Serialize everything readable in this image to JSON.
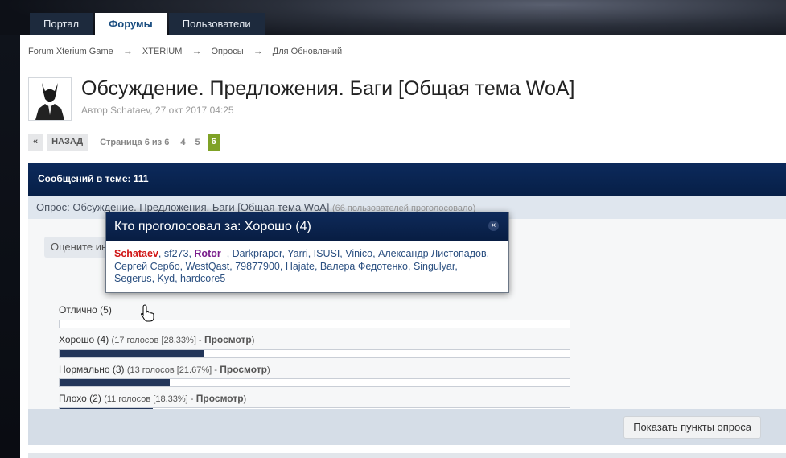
{
  "nav": {
    "tabs": [
      {
        "label": "Портал",
        "active": false
      },
      {
        "label": "Форумы",
        "active": true
      },
      {
        "label": "Пользователи",
        "active": false
      }
    ]
  },
  "breadcrumb": [
    "Forum Xterium Game",
    "XTERIUM",
    "Опросы",
    "Для Обновлений"
  ],
  "breadcrumb_separator": "→",
  "topic": {
    "title": "Обсуждение. Предложения. Баги [Общая тема WoA]",
    "meta": "Автор Schataev, 27 окт 2017 04:25"
  },
  "pager": {
    "prev": "«",
    "back": "НАЗАД",
    "info": "Страница 6 из 6",
    "pages": [
      "4",
      "5"
    ],
    "current": "6"
  },
  "thread": {
    "messages": "Сообщений в теме: 111"
  },
  "poll": {
    "header": "Опрос: Обсуждение. Предложения. Баги [Общая тема WoA]",
    "voted": "(66 пользователей проголосовало)",
    "question": "Оцените ин",
    "view_label": "Просмотр",
    "options": [
      {
        "label": "Отлично (5)",
        "info": "",
        "percent": 0
      },
      {
        "label": "Хорошо (4)",
        "info": "(17 голосов [28.33%] -",
        "percent": 28.33
      },
      {
        "label": "Нормально (3)",
        "info": "(13 голосов [21.67%] -",
        "percent": 21.67
      },
      {
        "label": "Плохо (2)",
        "info": "(11 голосов [18.33%] -",
        "percent": 18.33
      }
    ],
    "show_button": "Показать пункты опроса"
  },
  "popup": {
    "title": "Кто проголосовал за: Хорошо (4)",
    "close": "×",
    "voters": [
      {
        "name": "Schataev",
        "style": "red"
      },
      {
        "name": "sf273",
        "style": "normal"
      },
      {
        "name": "Rotor_",
        "style": "purple"
      },
      {
        "name": "Darkprapor",
        "style": "normal"
      },
      {
        "name": "Yarri",
        "style": "normal"
      },
      {
        "name": "ISUSI",
        "style": "normal"
      },
      {
        "name": "Vinico",
        "style": "normal"
      },
      {
        "name": "Александр Листопадов",
        "style": "normal"
      },
      {
        "name": "Сергей Сербо",
        "style": "normal"
      },
      {
        "name": "WestQast",
        "style": "normal"
      },
      {
        "name": "79877900",
        "style": "normal"
      },
      {
        "name": "Hajate",
        "style": "normal"
      },
      {
        "name": "Валера Федотенко",
        "style": "normal"
      },
      {
        "name": "Singulyar",
        "style": "normal"
      },
      {
        "name": "Segerus",
        "style": "normal"
      },
      {
        "name": "Kyd",
        "style": "normal"
      },
      {
        "name": "hardcore5",
        "style": "normal"
      }
    ]
  },
  "colors": {
    "accent_green": "#7fa226",
    "header_navy": "#0c2a5c",
    "voter_red": "#d01515",
    "voter_purple": "#7a1e8c"
  }
}
